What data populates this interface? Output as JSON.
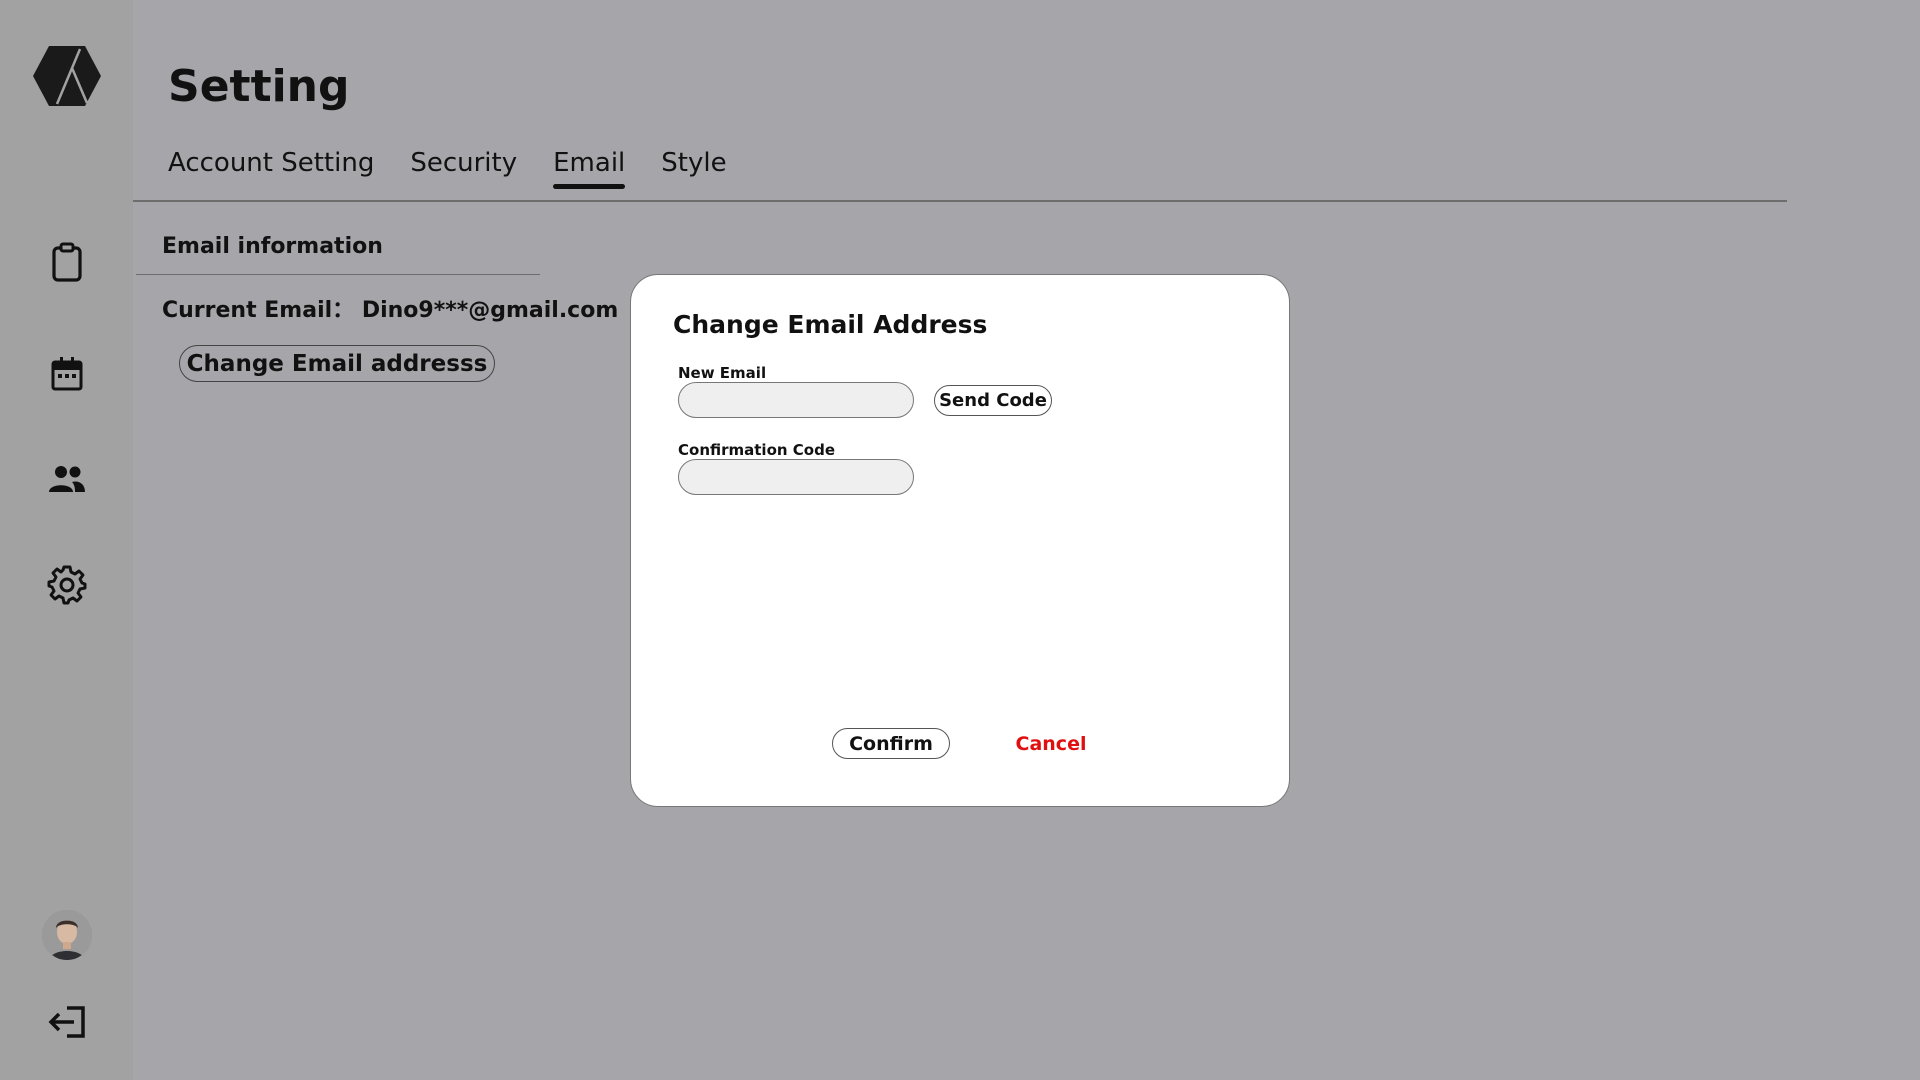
{
  "sidebar": {
    "logo_icon": "hexagon-logo-icon",
    "items": [
      {
        "icon": "clipboard-icon"
      },
      {
        "icon": "calendar-icon"
      },
      {
        "icon": "people-icon"
      },
      {
        "icon": "gear-icon"
      }
    ],
    "avatar_icon": "user-avatar",
    "logout_icon": "logout-icon"
  },
  "header": {
    "title": "Setting"
  },
  "tabs": [
    {
      "label": "Account Setting",
      "active": false
    },
    {
      "label": "Security",
      "active": false
    },
    {
      "label": "Email",
      "active": true
    },
    {
      "label": "Style",
      "active": false
    }
  ],
  "email_section": {
    "title": "Email information",
    "current_email_label": "Current Email：",
    "current_email_value": "Dino9***@gmail.com",
    "change_button": "Change Email addresss"
  },
  "modal": {
    "title": "Change Email Address",
    "new_email_label": "New Email",
    "new_email_value": "",
    "send_code_button": "Send Code",
    "confirmation_code_label": "Confirmation Code",
    "confirmation_code_value": "",
    "confirm_button": "Confirm",
    "cancel_button": "Cancel"
  },
  "colors": {
    "background": "#a6a5a9",
    "sidebar": "#a2a2a2",
    "modal_bg": "#ffffff",
    "cancel": "#e01010"
  }
}
